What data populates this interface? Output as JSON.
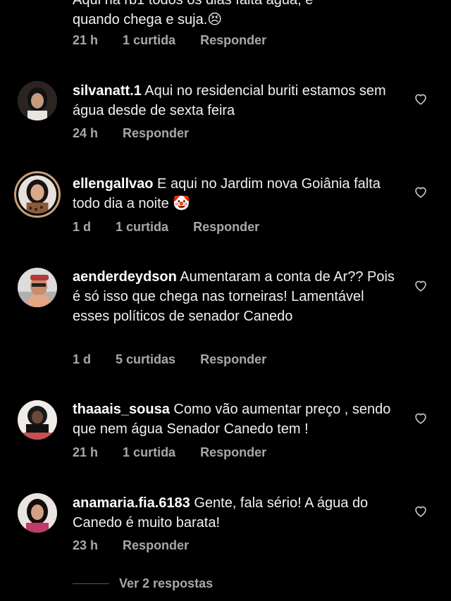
{
  "top_comment": {
    "line1": "Aqui na rb1 todos os dias falta água, e",
    "line2": "quando chega e suja.😣",
    "time": "21 h",
    "likes": "1 curtida",
    "reply": "Responder"
  },
  "comments": [
    {
      "username": "silvanatt.1",
      "text": " Aqui no residencial buriti estamos sem água desde de sexta feira",
      "time": "24 h",
      "likes": "",
      "reply": "Responder"
    },
    {
      "username": "ellengallvao",
      "text": " E aqui no Jardim nova Goiânia falta todo dia a noite 🤡",
      "time": "1 d",
      "likes": "1 curtida",
      "reply": "Responder"
    },
    {
      "username": "aenderdeydson",
      "text": " Aumentaram a conta de Ar?? Pois é só isso que chega nas torneiras! Lamentável esses políticos de senador Canedo",
      "time": "1 d",
      "likes": "5 curtidas",
      "reply": "Responder"
    },
    {
      "username": "thaaais_sousa",
      "text": " Como vão aumentar preço , sendo que nem água Senador Canedo tem !",
      "time": "21 h",
      "likes": "1 curtida",
      "reply": "Responder"
    },
    {
      "username": "anamaria.fia.6183",
      "text": " Gente, fala sério! A água do Canedo é muito barata!",
      "time": "23 h",
      "likes": "",
      "reply": "Responder"
    }
  ],
  "view_replies": "Ver 2 respostas",
  "icons": {
    "like": "heart-outline-icon"
  }
}
